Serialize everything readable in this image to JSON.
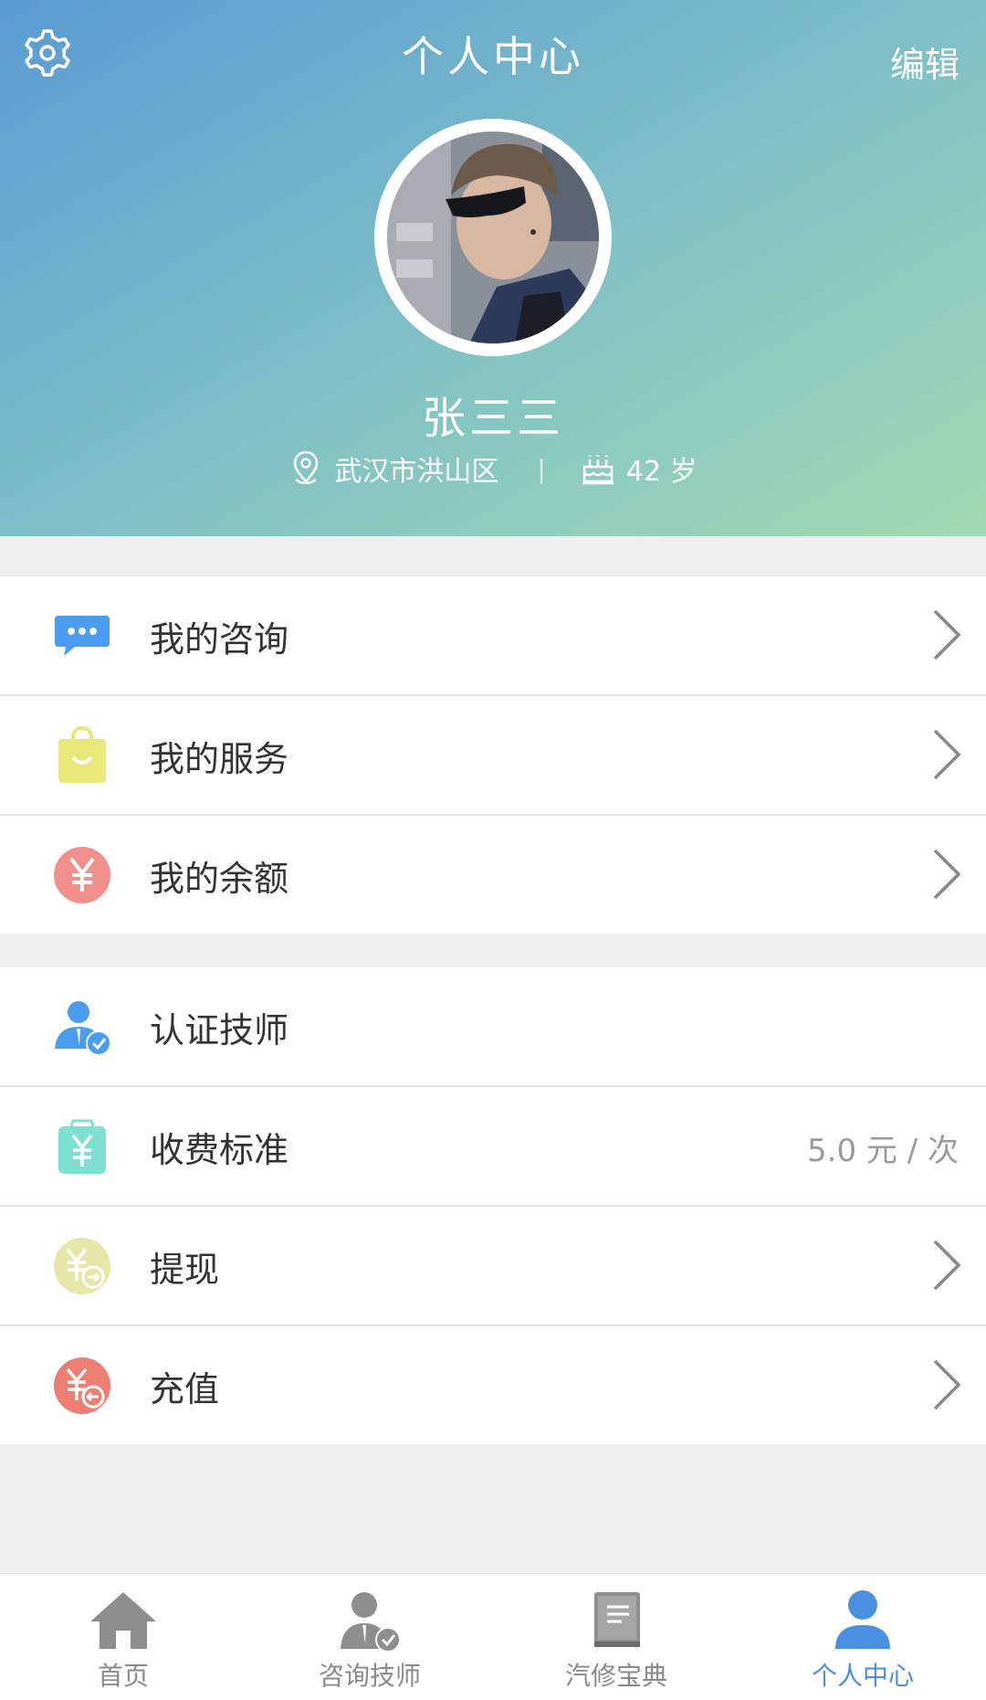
{
  "header": {
    "title": "个人中心",
    "edit_label": "编辑",
    "settings_icon": "gear-icon",
    "gradient_colors": [
      "#5a9bd4",
      "#a0dab2"
    ]
  },
  "profile": {
    "name": "张三三",
    "location": "武汉市洪山区",
    "separator": "|",
    "age": "42 岁",
    "location_icon": "location-pin-icon",
    "age_icon": "birthday-cake-icon"
  },
  "section1": [
    {
      "label": "我的咨询",
      "icon": "chat-bubble-icon",
      "color": "#4a9cf0"
    },
    {
      "label": "我的服务",
      "icon": "shopping-bag-icon",
      "color": "#e8e879"
    },
    {
      "label": "我的余额",
      "icon": "yen-circle-icon",
      "color": "#f08f8c"
    }
  ],
  "section2": [
    {
      "label": "认证技师",
      "icon": "certified-user-icon",
      "color": "#4a9cf0"
    },
    {
      "label": "收费标准",
      "icon": "yen-bag-icon",
      "color": "#7ee0d0",
      "value": "5.0 元 / 次"
    },
    {
      "label": "提现",
      "icon": "withdraw-icon",
      "color": "#e6e6a8"
    },
    {
      "label": "充值",
      "icon": "recharge-icon",
      "color": "#ee7e72"
    }
  ],
  "tabs": [
    {
      "label": "首页",
      "icon": "home-icon"
    },
    {
      "label": "咨询技师",
      "icon": "technician-icon"
    },
    {
      "label": "汽修宝典",
      "icon": "book-icon"
    },
    {
      "label": "个人中心",
      "icon": "person-icon",
      "active": true
    }
  ],
  "colors": {
    "accent": "#4a90e2",
    "page_bg": "#efefef",
    "chevron": "#888888"
  }
}
